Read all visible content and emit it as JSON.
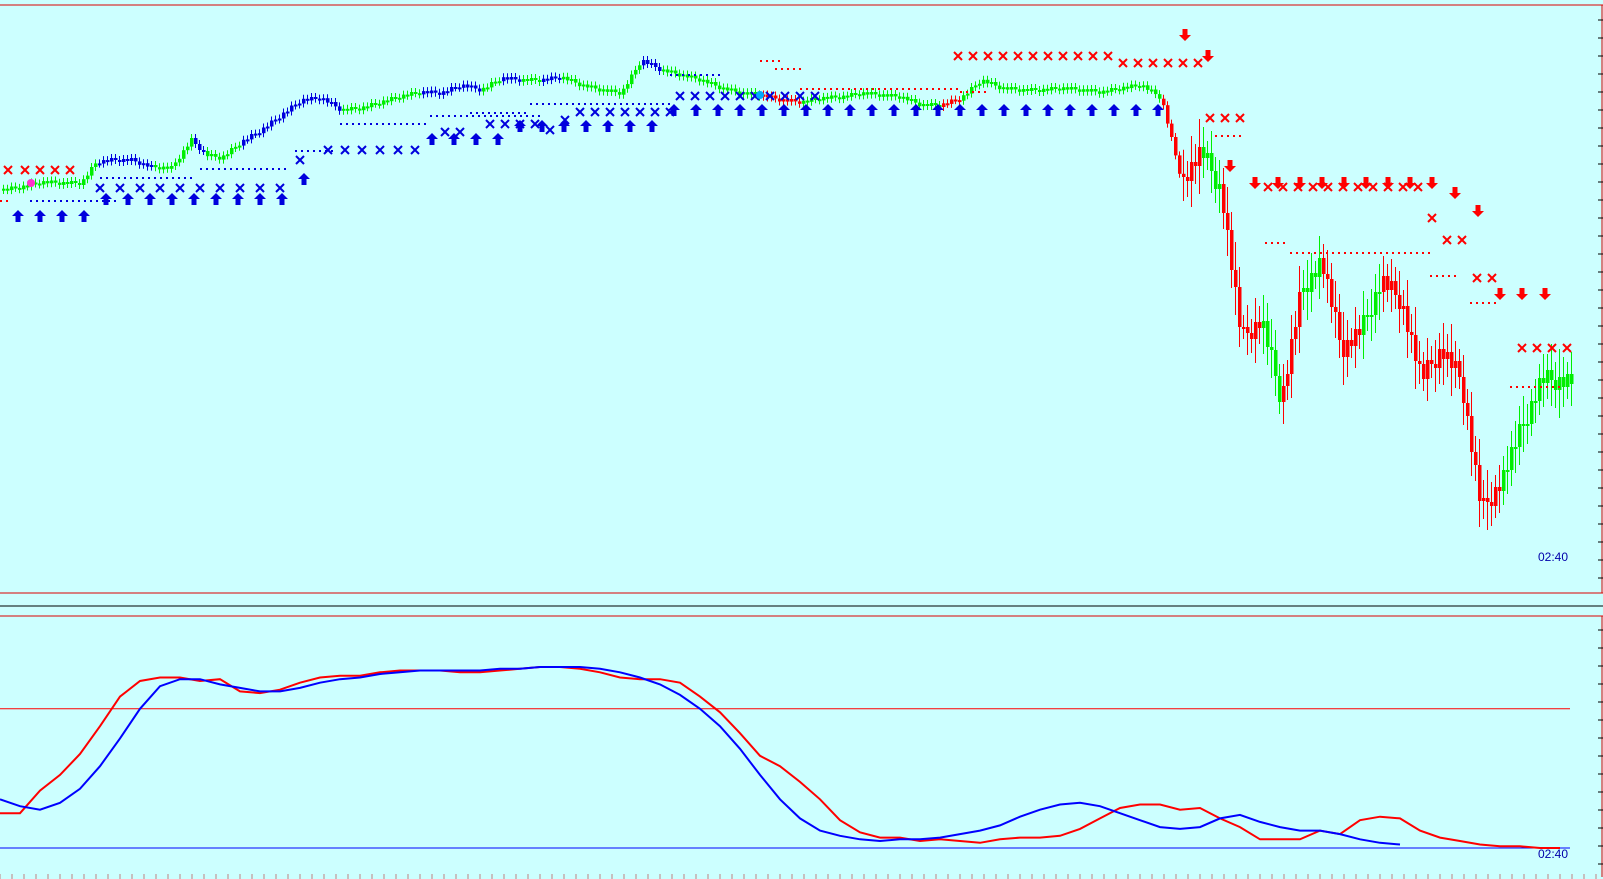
{
  "colors": {
    "background": "#ccffff",
    "bull_candle": "#00ee00",
    "bear_candle": "#ff0000",
    "neutral_candle": "#0000dd",
    "up_signal": "#0000dd",
    "down_signal": "#ff0000",
    "frame_line": "#dd0000",
    "fast_line": "#ff0000",
    "slow_line": "#0000ff",
    "upper_level": "#ff0000",
    "lower_level": "#0000ff",
    "label_text": "#0000aa",
    "magenta_marker": "#ff33cc",
    "cyan_marker": "#00aaff"
  },
  "chart_data": [
    {
      "type": "candlestick",
      "panel": "price",
      "title": "",
      "time_label": "02:40",
      "series": [
        {
          "kind": "price_path",
          "x": [
            0,
            20,
            40,
            60,
            80,
            95,
            110,
            130,
            150,
            170,
            190,
            205,
            220,
            240,
            260,
            280,
            300,
            320,
            340,
            360,
            380,
            400,
            420,
            440,
            460,
            480,
            500,
            520,
            540,
            560,
            580,
            600,
            620,
            640,
            660,
            680,
            700,
            720,
            740,
            760,
            780,
            800,
            820,
            840,
            860,
            880,
            900,
            920,
            940,
            960,
            980,
            1000,
            1020,
            1040,
            1060,
            1080,
            1100,
            1120,
            1140,
            1160,
            1180,
            1200,
            1220,
            1240,
            1260,
            1280,
            1300,
            1320,
            1340,
            1360,
            1380,
            1400,
            1420,
            1440,
            1460,
            1480,
            1500,
            1520,
            1540
          ],
          "close": [
            190,
            187,
            182,
            183,
            183,
            162,
            160,
            160,
            167,
            168,
            140,
            155,
            158,
            142,
            130,
            115,
            100,
            98,
            110,
            108,
            102,
            96,
            92,
            93,
            85,
            90,
            78,
            80,
            80,
            77,
            85,
            90,
            93,
            60,
            70,
            75,
            80,
            88,
            93,
            95,
            100,
            102,
            98,
            97,
            93,
            95,
            97,
            105,
            105,
            98,
            80,
            88,
            90,
            90,
            88,
            90,
            92,
            88,
            85,
            98,
            180,
            150,
            190,
            340,
            320,
            400,
            290,
            260,
            350,
            330,
            280,
            300,
            380,
            350,
            380,
            510,
            480,
            430,
            380
          ],
          "color": [
            "g",
            "g",
            "g",
            "g",
            "g",
            "b",
            "b",
            "b",
            "g",
            "g",
            "b",
            "g",
            "g",
            "b",
            "b",
            "b",
            "b",
            "b",
            "g",
            "g",
            "g",
            "g",
            "b",
            "b",
            "b",
            "g",
            "b",
            "g",
            "b",
            "g",
            "g",
            "g",
            "g",
            "b",
            "g",
            "g",
            "g",
            "g",
            "g",
            "r",
            "r",
            "g",
            "g",
            "g",
            "g",
            "g",
            "g",
            "g",
            "r",
            "g",
            "g",
            "g",
            "g",
            "g",
            "g",
            "g",
            "g",
            "g",
            "g",
            "r",
            "r",
            "g",
            "r",
            "r",
            "g",
            "r",
            "g",
            "r",
            "r",
            "g",
            "r",
            "r",
            "r",
            "r",
            "r",
            "r",
            "g",
            "g",
            "g"
          ]
        }
      ],
      "signals": {
        "up_arrows_x": [
          18,
          40,
          62,
          84,
          106,
          128,
          150,
          172,
          194,
          216,
          238,
          260,
          282,
          304,
          432,
          454,
          476,
          498,
          520,
          542,
          564,
          586,
          608,
          630,
          652,
          674,
          696,
          718,
          740,
          762,
          784,
          806,
          828,
          850,
          872,
          894,
          916,
          938,
          960,
          982,
          1004,
          1026,
          1048,
          1070,
          1092,
          1114,
          1136,
          1158
        ],
        "down_arrows_x": [
          1185,
          1208,
          1230,
          1255,
          1278,
          1300,
          1322,
          1344,
          1366,
          1388,
          1410,
          1432,
          1455,
          1478,
          1500,
          1522,
          1545
        ]
      }
    },
    {
      "type": "line",
      "panel": "oscillator",
      "title": "",
      "time_label": "02:40",
      "x": [
        0,
        20,
        40,
        60,
        80,
        100,
        120,
        140,
        160,
        180,
        200,
        220,
        240,
        260,
        280,
        300,
        320,
        340,
        360,
        380,
        400,
        420,
        440,
        460,
        480,
        500,
        520,
        540,
        560,
        580,
        600,
        620,
        640,
        660,
        680,
        700,
        720,
        740,
        760,
        780,
        800,
        820,
        840,
        860,
        880,
        900,
        920,
        940,
        960,
        980,
        1000,
        1020,
        1040,
        1060,
        1080,
        1100,
        1120,
        1140,
        1160,
        1180,
        1200,
        1220,
        1240,
        1260,
        1280,
        1300,
        1320,
        1340,
        1360,
        1380,
        1400,
        1420,
        1440,
        1460,
        1480,
        1500,
        1520,
        1540,
        1560
      ],
      "series": [
        {
          "values": [
            20,
            20,
            33,
            42,
            54,
            70,
            87,
            96,
            98,
            98,
            96,
            97,
            90,
            89,
            91,
            95,
            98,
            99,
            99,
            101,
            102,
            102,
            102,
            101,
            101,
            102,
            103,
            104,
            104,
            103,
            101,
            98,
            97,
            97,
            95,
            87,
            78,
            66,
            53,
            47,
            38,
            28,
            16,
            9,
            6,
            6,
            4,
            5,
            4,
            3,
            5,
            6,
            6,
            7,
            11,
            17,
            23,
            25,
            25,
            22,
            23,
            17,
            12,
            5,
            5,
            5,
            10,
            8,
            16,
            18,
            17,
            10,
            6,
            4,
            2,
            1,
            1,
            0,
            0
          ]
        },
        {
          "values": [
            28,
            24,
            22,
            26,
            34,
            47,
            63,
            80,
            93,
            97,
            97,
            94,
            92,
            90,
            90,
            92,
            95,
            97,
            98,
            100,
            101,
            102,
            102,
            102,
            102,
            103,
            103,
            104,
            104,
            104,
            103,
            101,
            98,
            94,
            88,
            80,
            70,
            57,
            42,
            28,
            17,
            10,
            7,
            5,
            4,
            5,
            5,
            6,
            8,
            10,
            13,
            18,
            22,
            25,
            26,
            24,
            20,
            16,
            12,
            11,
            12,
            17,
            19,
            15,
            12,
            10,
            10,
            8,
            5,
            3,
            2
          ]
        }
      ],
      "upper_level": 80,
      "lower_level": 0
    }
  ]
}
